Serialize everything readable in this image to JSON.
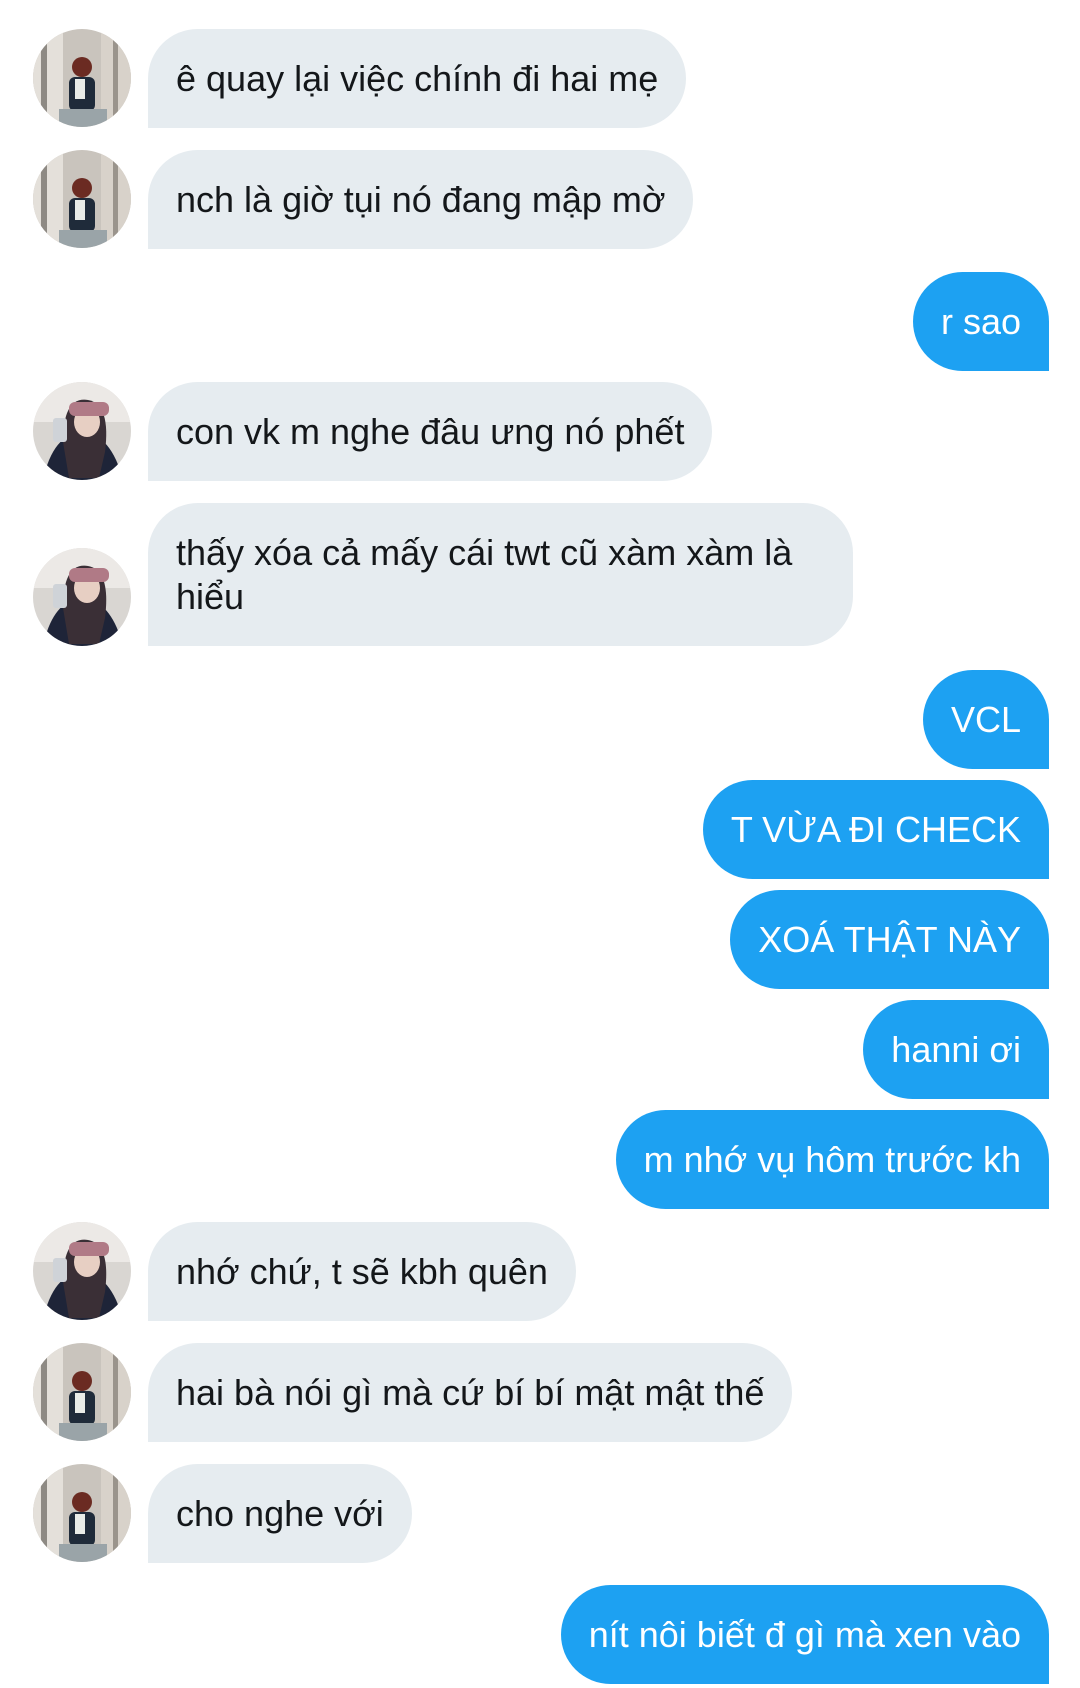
{
  "conversation": {
    "messages": [
      {
        "side": "in",
        "avatar": "avatar-a",
        "text": "ê quay lại việc chính đi hai mẹ"
      },
      {
        "side": "in",
        "avatar": "avatar-a",
        "text": "nch là giờ tụi nó đang mập mờ"
      },
      {
        "side": "out",
        "text": "r sao"
      },
      {
        "side": "in",
        "avatar": "avatar-b",
        "text": "con vk m nghe đâu ưng nó phết"
      },
      {
        "side": "in",
        "avatar": "avatar-b",
        "text": "thấy xóa cả mấy cái twt cũ xàm xàm là hiểu"
      },
      {
        "side": "out",
        "text": "VCL"
      },
      {
        "side": "out",
        "text": "T VỪA ĐI CHECK"
      },
      {
        "side": "out",
        "text": "XOÁ THẬT NÀY"
      },
      {
        "side": "out",
        "text": "hanni ơi"
      },
      {
        "side": "out",
        "text": "m nhớ vụ hôm trước kh"
      },
      {
        "side": "in",
        "avatar": "avatar-b",
        "text": "nhớ chứ, t sẽ kbh quên"
      },
      {
        "side": "in",
        "avatar": "avatar-a",
        "text": "hai bà nói gì mà cứ bí bí mật mật thế"
      },
      {
        "side": "in",
        "avatar": "avatar-a",
        "text": "cho nghe với"
      },
      {
        "side": "out",
        "text": "nít nôi biết đ gì mà xen vào"
      }
    ]
  },
  "colors": {
    "incoming_bubble": "#e6ecf0",
    "outgoing_bubble": "#1da1f2",
    "incoming_text": "#14171a",
    "outgoing_text": "#ffffff"
  }
}
